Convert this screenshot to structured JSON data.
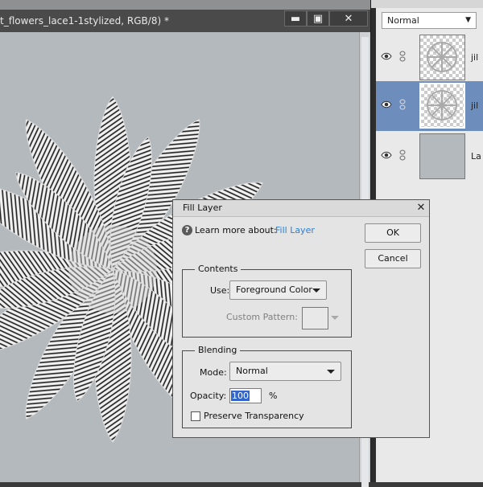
{
  "document": {
    "title": "t_flowers_lace1-1stylized, RGB/8) *",
    "minimize_glyph": "▬",
    "maximize_glyph": "▣",
    "close_glyph": "✕"
  },
  "layers_panel": {
    "blend_mode": "Normal",
    "layers": [
      {
        "name": "jil",
        "selected": false,
        "thumb": "transparent-lace"
      },
      {
        "name": "jil",
        "selected": true,
        "thumb": "transparent-lace"
      },
      {
        "name": "La",
        "selected": false,
        "thumb": "solid-gray"
      }
    ]
  },
  "dialog": {
    "title": "Fill Layer",
    "close_glyph": "✕",
    "help_glyph": "?",
    "learn_text": "Learn more about:",
    "learn_link": "Fill Layer",
    "ok_label": "OK",
    "cancel_label": "Cancel",
    "contents": {
      "label": "Contents",
      "use_label": "Use:",
      "use_value": "Foreground Color",
      "custom_pattern_label": "Custom Pattern:"
    },
    "blending": {
      "label": "Blending",
      "mode_label": "Mode:",
      "mode_value": "Normal",
      "opacity_label": "Opacity:",
      "opacity_value": "100",
      "opacity_unit": "%",
      "preserve_label": "Preserve Transparency",
      "preserve_checked": false
    }
  },
  "colors": {
    "canvas_bg": "#b3b9bd",
    "selected_layer": "#6d8ebd",
    "link": "#2b7fd8"
  }
}
